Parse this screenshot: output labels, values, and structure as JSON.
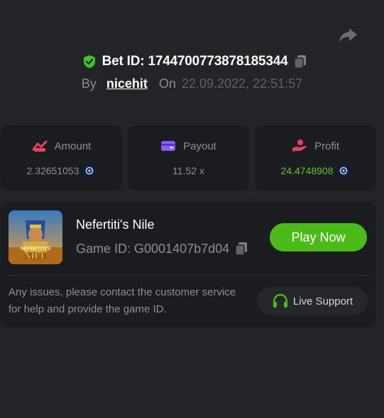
{
  "header": {
    "bet_id": "Bet ID: 1744700773878185344",
    "by_label": "By",
    "username": "nicehit",
    "on_label": "On",
    "datetime": "22.09.2022, 22:51:57"
  },
  "stats": {
    "amount": {
      "label": "Amount",
      "value": "2.32651053"
    },
    "payout": {
      "label": "Payout",
      "value": "11.52 x"
    },
    "profit": {
      "label": "Profit",
      "value": "24.4748908"
    }
  },
  "game": {
    "name": "Nefertiti's Nile",
    "game_id": "Game ID: G0001407b7d04",
    "play_label": "Play Now",
    "thumb_title": "NEFERTITI'S",
    "thumb_sub": "NILE"
  },
  "support": {
    "notice": "Any issues, please contact the customer service for help and provide the game ID.",
    "button_label": "Live Support"
  },
  "colors": {
    "background": "#232427",
    "card": "#1b1c1f",
    "accent_green": "#4cba18",
    "profit_green": "#5cc72c",
    "muted_text": "#8b8e96"
  },
  "icons": [
    "share-icon",
    "shield-check-icon",
    "copy-icon",
    "amount-icon",
    "wallet-icon",
    "profit-hand-icon",
    "coin-icon",
    "headset-icon"
  ]
}
